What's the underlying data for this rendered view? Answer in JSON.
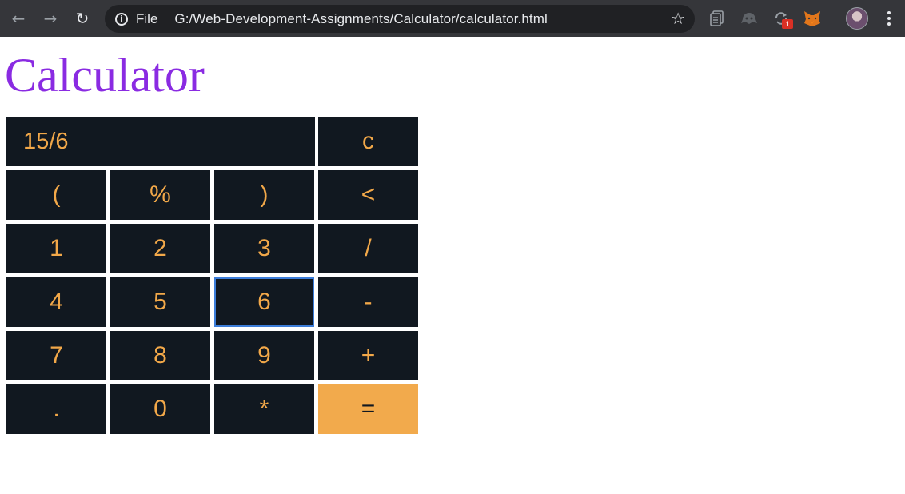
{
  "browser": {
    "back_icon": "arrow-left-icon",
    "forward_icon": "arrow-right-icon",
    "reload_icon": "reload-icon",
    "scheme_label": "File",
    "url": "G:/Web-Development-Assignments/Calculator/calculator.html",
    "extension_badge": "1"
  },
  "page": {
    "title": "Calculator"
  },
  "calculator": {
    "display": "15/6",
    "clear": "c",
    "rows": [
      [
        "(",
        "%",
        ")",
        "<"
      ],
      [
        "1",
        "2",
        "3",
        "/"
      ],
      [
        "4",
        "5",
        "6",
        "-"
      ],
      [
        "7",
        "8",
        "9",
        "+"
      ],
      [
        ".",
        "0",
        "*",
        "="
      ]
    ]
  },
  "colors": {
    "title": "#8a2be2",
    "key_bg": "#111820",
    "key_text": "#f2a849",
    "equals_bg": "#f2aa4c",
    "focus_ring": "#3c7dd9"
  }
}
